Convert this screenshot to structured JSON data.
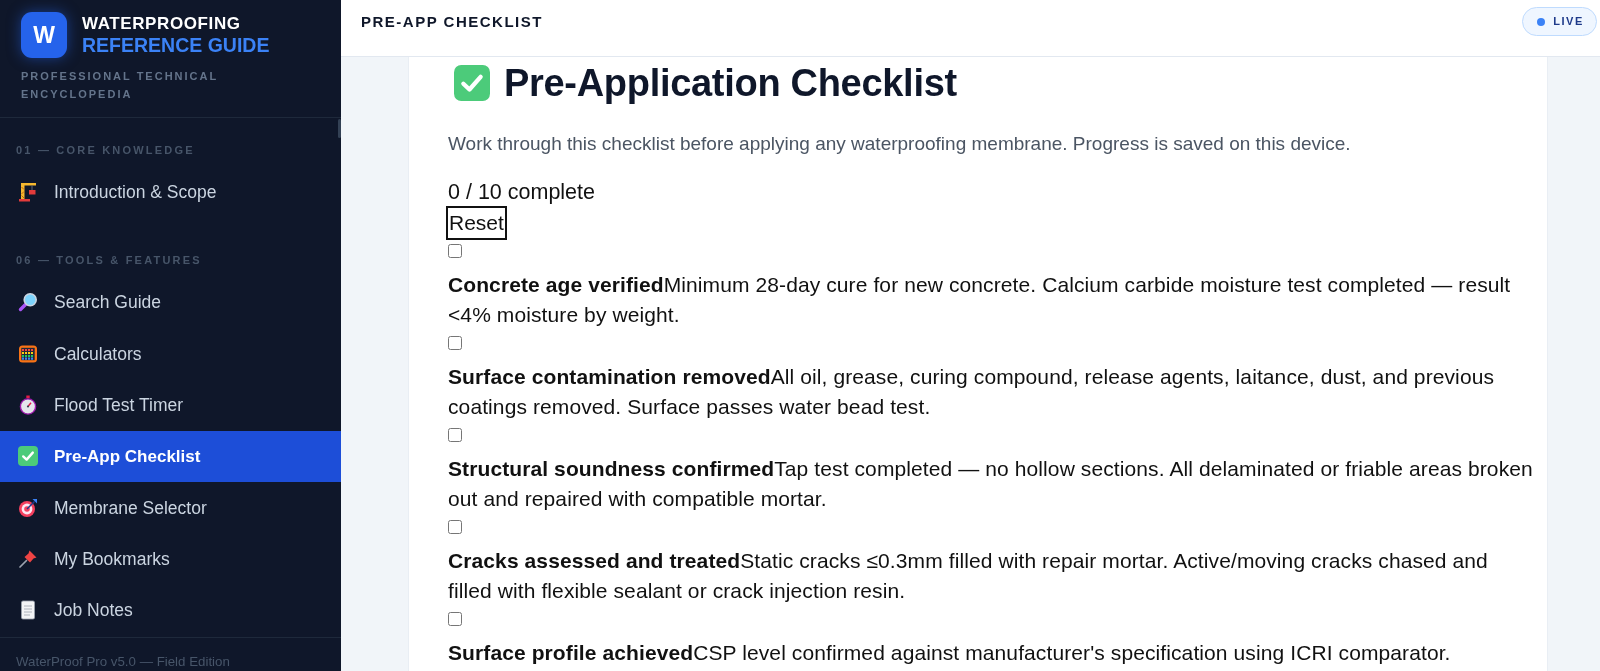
{
  "sidebar": {
    "logo_letter": "W",
    "brand_line_1": "WATERPROOFING",
    "brand_line_2": "REFERENCE GUIDE",
    "tagline": "PROFESSIONAL TECHNICAL ENCYCLOPEDIA",
    "sections": [
      {
        "label": "01 — CORE KNOWLEDGE",
        "items": [
          {
            "label": "Introduction & Scope",
            "selected": false
          }
        ]
      },
      {
        "label": "06 — TOOLS & FEATURES",
        "items": [
          {
            "label": "Search Guide",
            "selected": false
          },
          {
            "label": "Calculators",
            "selected": false
          },
          {
            "label": "Flood Test Timer",
            "selected": false
          },
          {
            "label": "Pre-App Checklist",
            "selected": true
          },
          {
            "label": "Membrane Selector",
            "selected": false
          },
          {
            "label": "My Bookmarks",
            "selected": false
          },
          {
            "label": "Job Notes",
            "selected": false
          }
        ]
      }
    ],
    "footer": "WaterProof Pro v5.0 — Field Edition"
  },
  "header": {
    "title": "PRE-APP CHECKLIST",
    "status_badge": "LIVE"
  },
  "page": {
    "heading": "Pre-Application Checklist",
    "intro": "Work through this checklist before applying any waterproofing membrane. Progress is saved on this device.",
    "progress": "0 / 10 complete",
    "reset_button": "Reset",
    "checklist": [
      {
        "text": "**Concrete age verified**Minimum 28-day cure for new concrete. Calcium carbide moisture test completed — result <4% moisture by weight.",
        "checked": false
      },
      {
        "text": "**Surface contamination removed**All oil, grease, curing compound, release agents, laitance, dust, and previous coatings removed. Surface passes water bead test.",
        "checked": false
      },
      {
        "text": "**Structural soundness confirmed**Tap test completed — no hollow sections. All delaminated or friable areas broken out and repaired with compatible mortar.",
        "checked": false
      },
      {
        "text": "**Cracks assessed and treated**Static cracks ≤0.3mm filled with repair mortar. Active/moving cracks chased and filled with flexible sealant or crack injection resin.",
        "checked": false
      },
      {
        "text": "**Surface profile achieved**CSP level confirmed against manufacturer's specification using ICRI comparator.",
        "checked": false
      }
    ]
  }
}
